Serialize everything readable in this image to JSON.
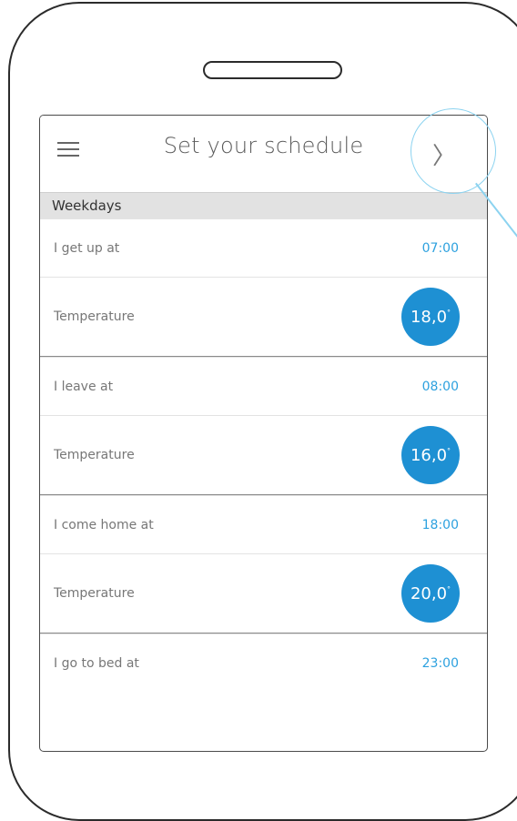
{
  "header": {
    "title": "Set your schedule",
    "menu_icon": "hamburger-icon",
    "next_icon": "chevron-right-icon"
  },
  "section": {
    "label": "Weekdays"
  },
  "rows": [
    {
      "label": "I get up at",
      "value": "07:00",
      "type": "time"
    },
    {
      "label": "Temperature",
      "value": "18,0",
      "unit": "°",
      "type": "temp"
    },
    {
      "label": "I leave at",
      "value": "08:00",
      "type": "time"
    },
    {
      "label": "Temperature",
      "value": "16,0",
      "unit": "°",
      "type": "temp"
    },
    {
      "label": "I come home at",
      "value": "18:00",
      "type": "time"
    },
    {
      "label": "Temperature",
      "value": "20,0",
      "unit": "°",
      "type": "temp"
    },
    {
      "label": "I go to bed at",
      "value": "23:00",
      "type": "time"
    }
  ],
  "colors": {
    "accent": "#1e90d3",
    "time_text": "#2da1df",
    "section_bg": "#e2e2e2",
    "highlight": "#8cd3f0"
  }
}
